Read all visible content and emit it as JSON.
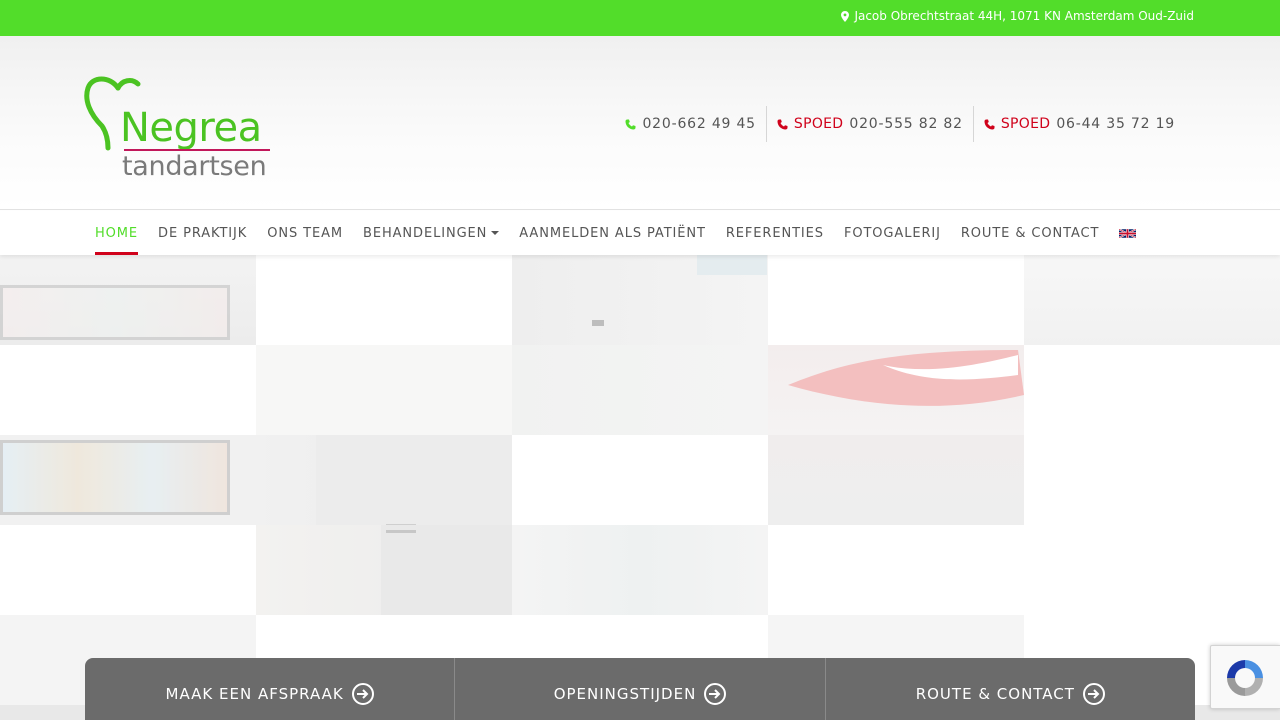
{
  "topbar": {
    "address": "Jacob Obrechtstraat 44H, 1071 KN Amsterdam Oud-Zuid",
    "icon": "map-marker-icon"
  },
  "logo": {
    "brand": "Negrea",
    "sub": "tandartsen",
    "brand_color": "#4bc322",
    "accent_color": "#c2185b"
  },
  "phones": [
    {
      "label": "",
      "number": "020-662 49 45",
      "icon_color": "#52dd2a"
    },
    {
      "label": "SPOED",
      "number": "020-555 82 82",
      "icon_color": "#d0021b"
    },
    {
      "label": "SPOED",
      "number": "06-44 35 72 19",
      "icon_color": "#d0021b"
    }
  ],
  "nav": {
    "items": [
      {
        "label": "HOME",
        "active": true
      },
      {
        "label": "DE PRAKTIJK"
      },
      {
        "label": "ONS TEAM"
      },
      {
        "label": "BEHANDELINGEN",
        "dropdown": true
      },
      {
        "label": "AANMELDEN ALS PATIËNT"
      },
      {
        "label": "REFERENTIES"
      },
      {
        "label": "FOTOGALERIJ"
      },
      {
        "label": "ROUTE & CONTACT"
      }
    ],
    "language_flag": "uk-flag-icon"
  },
  "actions": [
    {
      "label": "MAAK EEN AFSPRAAK",
      "icon": "arrow-circle-right-icon"
    },
    {
      "label": "OPENINGSTIJDEN",
      "icon": "arrow-circle-right-icon"
    },
    {
      "label": "ROUTE & CONTACT",
      "icon": "arrow-circle-right-icon"
    }
  ],
  "colors": {
    "green": "#52dd2a",
    "red": "#d0021b",
    "action_bar": "#6b6b6b"
  }
}
